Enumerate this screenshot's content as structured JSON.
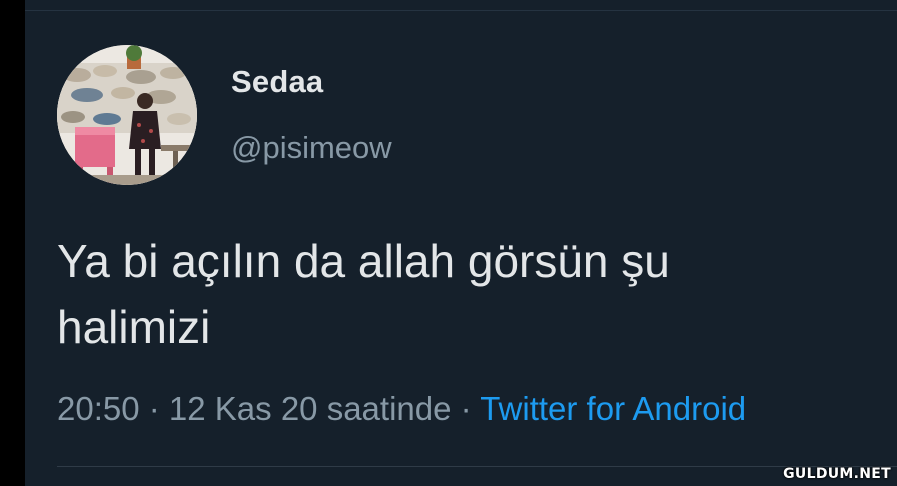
{
  "tweet": {
    "display_name": "Sedaa",
    "handle": "@pisimeow",
    "text_line1": "Ya bi açılın da allah görsün şu",
    "text_line2": "halimizi",
    "time": "20:50",
    "sep1": " · ",
    "date": "12 Kas 20 saatinde",
    "sep2": " · ",
    "source": "Twitter for Android"
  },
  "watermark": "GULDUM.NET",
  "colors": {
    "background": "#15202b",
    "text": "#e3e6e8",
    "secondary": "#8899a6",
    "link": "#1d9bf0"
  }
}
